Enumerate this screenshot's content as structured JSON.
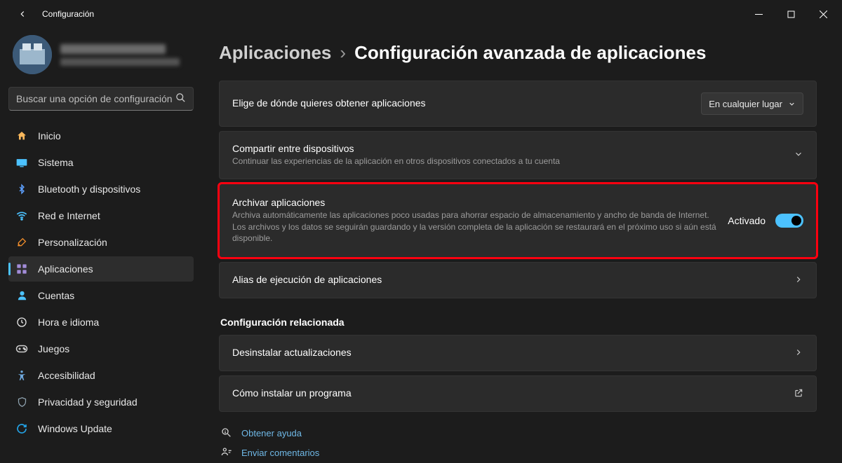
{
  "window": {
    "title": "Configuración"
  },
  "search": {
    "placeholder": "Buscar una opción de configuración"
  },
  "nav": {
    "items": [
      {
        "id": "home",
        "label": "Inicio"
      },
      {
        "id": "system",
        "label": "Sistema"
      },
      {
        "id": "bt",
        "label": "Bluetooth y dispositivos"
      },
      {
        "id": "net",
        "label": "Red e Internet"
      },
      {
        "id": "pers",
        "label": "Personalización"
      },
      {
        "id": "apps",
        "label": "Aplicaciones",
        "active": true
      },
      {
        "id": "acct",
        "label": "Cuentas"
      },
      {
        "id": "time",
        "label": "Hora e idioma"
      },
      {
        "id": "game",
        "label": "Juegos"
      },
      {
        "id": "acc",
        "label": "Accesibilidad"
      },
      {
        "id": "priv",
        "label": "Privacidad y seguridad"
      },
      {
        "id": "upd",
        "label": "Windows Update"
      }
    ]
  },
  "breadcrumb": {
    "root": "Aplicaciones",
    "leaf": "Configuración avanzada de aplicaciones"
  },
  "cards": {
    "source": {
      "title": "Elige de dónde quieres obtener aplicaciones",
      "dropdown": "En cualquier lugar"
    },
    "share": {
      "title": "Compartir entre dispositivos",
      "desc": "Continuar las experiencias de la aplicación en otros dispositivos conectados a tu cuenta"
    },
    "archive": {
      "title": "Archivar aplicaciones",
      "desc": "Archiva automáticamente las aplicaciones poco usadas para ahorrar espacio de almacenamiento y ancho de banda de Internet. Los archivos y los datos se seguirán guardando y la versión completa de la aplicación se restaurará en el próximo uso si aún está disponible.",
      "state": "Activado",
      "toggle": true
    },
    "alias": {
      "title": "Alias de ejecución de aplicaciones"
    },
    "related_heading": "Configuración relacionada",
    "uninstall": {
      "title": "Desinstalar actualizaciones"
    },
    "howto": {
      "title": "Cómo instalar un programa"
    }
  },
  "links": {
    "help": "Obtener ayuda",
    "feedback": "Enviar comentarios"
  }
}
